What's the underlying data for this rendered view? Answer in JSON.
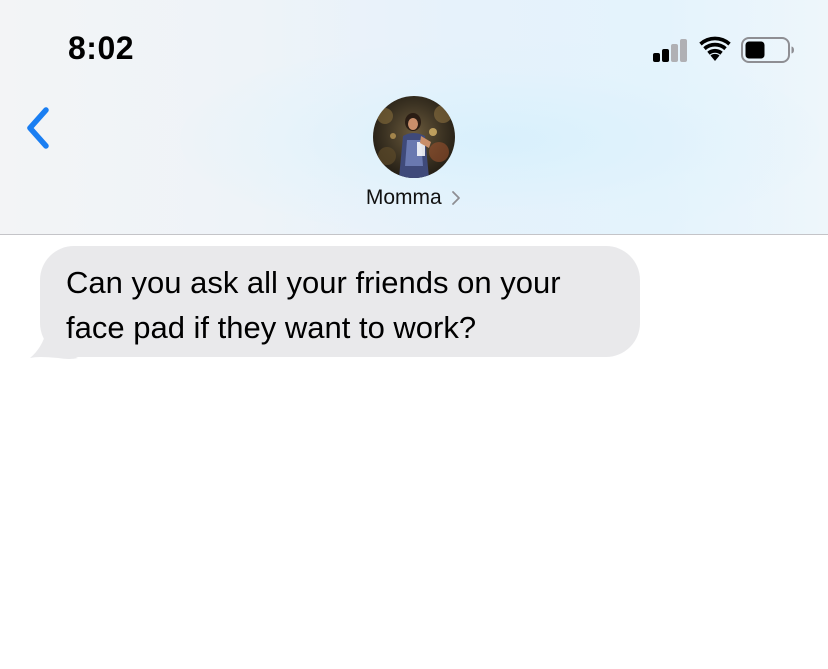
{
  "status_bar": {
    "time": "8:02",
    "signal_bars_filled": 2,
    "signal_bars_total": 4,
    "battery_level": 0.45,
    "icons": [
      "signal-icon",
      "wifi-icon",
      "battery-icon"
    ]
  },
  "nav": {
    "back_icon": "chevron-left-icon",
    "contact_name": "Momma",
    "contact_chevron_icon": "chevron-right-icon"
  },
  "messages": [
    {
      "direction": "incoming",
      "text": "Can you ask all your friends on your face pad if they want to work?"
    }
  ],
  "colors": {
    "accent": "#1a7ef2",
    "incoming_bubble": "#e9e9eb",
    "text": "#000000"
  }
}
